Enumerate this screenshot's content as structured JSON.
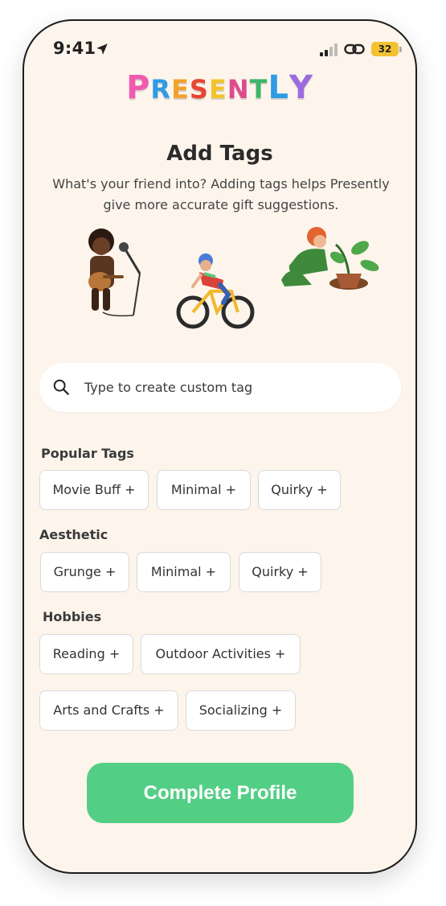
{
  "status_bar": {
    "time": "9:41",
    "battery": "32"
  },
  "logo": {
    "letters": [
      {
        "ch": "P",
        "color": "#f05ab0"
      },
      {
        "ch": "R",
        "color": "#2e9be6"
      },
      {
        "ch": "E",
        "color": "#f2a12c"
      },
      {
        "ch": "S",
        "color": "#e8452e"
      },
      {
        "ch": "E",
        "color": "#f3c22e"
      },
      {
        "ch": "N",
        "color": "#e04a8e"
      },
      {
        "ch": "T",
        "color": "#3fb56a"
      },
      {
        "ch": "L",
        "color": "#2e9be6"
      },
      {
        "ch": "Y",
        "color": "#9b6be0"
      }
    ]
  },
  "header": {
    "title": "Add Tags",
    "subtitle": "What's your friend into? Adding tags helps Presently give more accurate gift suggestions."
  },
  "search": {
    "placeholder": "Type to create custom tag",
    "value": ""
  },
  "sections": {
    "popular": {
      "label": "Popular Tags",
      "tags": [
        "Movie Buff +",
        "Minimal +",
        "Quirky +"
      ]
    },
    "aesthetic": {
      "label": "Aesthetic",
      "tags": [
        "Grunge +",
        "Minimal +",
        "Quirky +"
      ]
    },
    "hobbies": {
      "label": "Hobbies",
      "tags": [
        "Reading +",
        "Outdoor Activities +",
        "Arts and Crafts +",
        "Socializing +"
      ]
    }
  },
  "cta": {
    "label": "Complete Profile",
    "color": "#53cf85"
  },
  "colors": {
    "background": "#fdf5ec",
    "chip_border": "#d9d9d9",
    "text": "#2b2b2b"
  }
}
